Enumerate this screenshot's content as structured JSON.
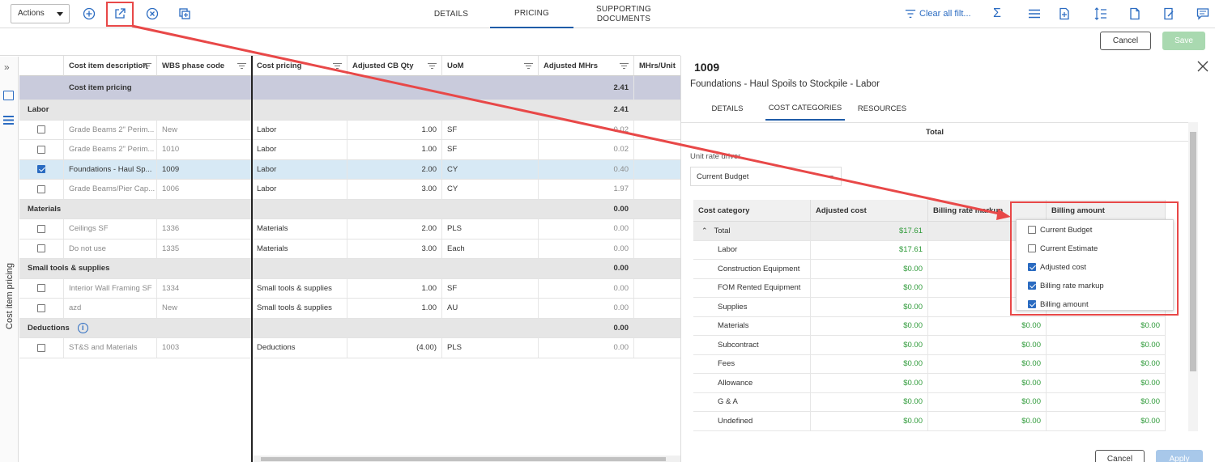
{
  "toolbar": {
    "actions_label": "Actions",
    "tabs": [
      {
        "label": "DETAILS"
      },
      {
        "label": "PRICING"
      },
      {
        "label": "SUPPORTING\nDOCUMENTS"
      }
    ],
    "clear_filters_label": "Clear all filt...",
    "cancel_label": "Cancel",
    "save_label": "Save"
  },
  "side": {
    "vertical_label": "Cost item pricing"
  },
  "grid": {
    "columns": [
      "Cost item description",
      "WBS phase code",
      "Cost pricing",
      "Adjusted CB Qty",
      "UoM",
      "Adjusted MHrs",
      "MHrs/Unit"
    ],
    "pricing_row": {
      "label": "Cost item pricing",
      "mhrs": "2.41"
    },
    "rows": [
      {
        "type": "group",
        "label": "Labor",
        "mhrs": "2.41"
      },
      {
        "type": "item",
        "checked": false,
        "desc": "Grade Beams 2\" Perim...",
        "wbs": "New",
        "pricing": "Labor",
        "qty": "1.00",
        "uom": "SF",
        "mhrs": "0.02"
      },
      {
        "type": "item",
        "checked": false,
        "desc": "Grade Beams 2\" Perim...",
        "wbs": "1010",
        "pricing": "Labor",
        "qty": "1.00",
        "uom": "SF",
        "mhrs": "0.02"
      },
      {
        "type": "item",
        "checked": true,
        "desc": "Foundations - Haul Sp...",
        "wbs": "1009",
        "pricing": "Labor",
        "qty": "2.00",
        "uom": "CY",
        "mhrs": "0.40"
      },
      {
        "type": "item",
        "checked": false,
        "desc": "Grade Beams/Pier Cap...",
        "wbs": "1006",
        "pricing": "Labor",
        "qty": "3.00",
        "uom": "CY",
        "mhrs": "1.97"
      },
      {
        "type": "group",
        "label": "Materials",
        "mhrs": "0.00"
      },
      {
        "type": "item",
        "checked": false,
        "desc": "Ceilings SF",
        "wbs": "1336",
        "pricing": "Materials",
        "qty": "2.00",
        "uom": "PLS",
        "mhrs": "0.00"
      },
      {
        "type": "item",
        "checked": false,
        "desc": "Do not use",
        "wbs": "1335",
        "pricing": "Materials",
        "qty": "3.00",
        "uom": "Each",
        "mhrs": "0.00"
      },
      {
        "type": "group",
        "label": "Small tools & supplies",
        "mhrs": "0.00"
      },
      {
        "type": "item",
        "checked": false,
        "desc": "Interior Wall Framing SF",
        "wbs": "1334",
        "pricing": "Small tools & supplies",
        "qty": "1.00",
        "uom": "SF",
        "mhrs": "0.00"
      },
      {
        "type": "item",
        "checked": false,
        "desc": "azd",
        "wbs": "New",
        "pricing": "Small tools & supplies",
        "qty": "1.00",
        "uom": "AU",
        "mhrs": "0.00"
      },
      {
        "type": "group",
        "label": "Deductions",
        "mhrs": "0.00",
        "info": true
      },
      {
        "type": "item",
        "checked": false,
        "desc": "ST&S and Materials",
        "wbs": "1003",
        "pricing": "Deductions",
        "qty": "(4.00)",
        "uom": "PLS",
        "mhrs": "0.00"
      }
    ]
  },
  "panel": {
    "title": "1009",
    "subtitle": "Foundations - Haul Spoils to Stockpile - Labor",
    "tabs": [
      "DETAILS",
      "COST CATEGORIES",
      "RESOURCES"
    ],
    "total_header": "Total",
    "unit_rate_label": "Unit rate driver",
    "unit_rate_value": "Current Budget",
    "table_columns": [
      "Cost category",
      "Adjusted cost",
      "Billing rate markup",
      "Billing amount"
    ],
    "rows": [
      {
        "name": "Total",
        "adj": "$17.61",
        "markup": "",
        "billing": "",
        "total": true
      },
      {
        "name": "Labor",
        "adj": "$17.61",
        "markup": "",
        "billing": ""
      },
      {
        "name": "Construction Equipment",
        "adj": "$0.00",
        "markup": "",
        "billing": ""
      },
      {
        "name": "FOM Rented Equipment",
        "adj": "$0.00",
        "markup": "",
        "billing": ""
      },
      {
        "name": "Supplies",
        "adj": "$0.00",
        "markup": "",
        "billing": ""
      },
      {
        "name": "Materials",
        "adj": "$0.00",
        "markup": "$0.00",
        "billing": "$0.00"
      },
      {
        "name": "Subcontract",
        "adj": "$0.00",
        "markup": "$0.00",
        "billing": "$0.00"
      },
      {
        "name": "Fees",
        "adj": "$0.00",
        "markup": "$0.00",
        "billing": "$0.00"
      },
      {
        "name": "Allowance",
        "adj": "$0.00",
        "markup": "$0.00",
        "billing": "$0.00"
      },
      {
        "name": "G & A",
        "adj": "$0.00",
        "markup": "$0.00",
        "billing": "$0.00"
      },
      {
        "name": "Undefined",
        "adj": "$0.00",
        "markup": "$0.00",
        "billing": "$0.00"
      }
    ],
    "cancel_label": "Cancel",
    "apply_label": "Apply"
  },
  "column_chooser": [
    {
      "label": "Current Budget",
      "checked": false
    },
    {
      "label": "Current Estimate",
      "checked": false
    },
    {
      "label": "Adjusted cost",
      "checked": true
    },
    {
      "label": "Billing rate markup",
      "checked": true
    },
    {
      "label": "Billing amount",
      "checked": true
    }
  ],
  "colors": {
    "accent": "#2a6bc1",
    "annotation": "#e84848",
    "money": "#2e9a39"
  }
}
